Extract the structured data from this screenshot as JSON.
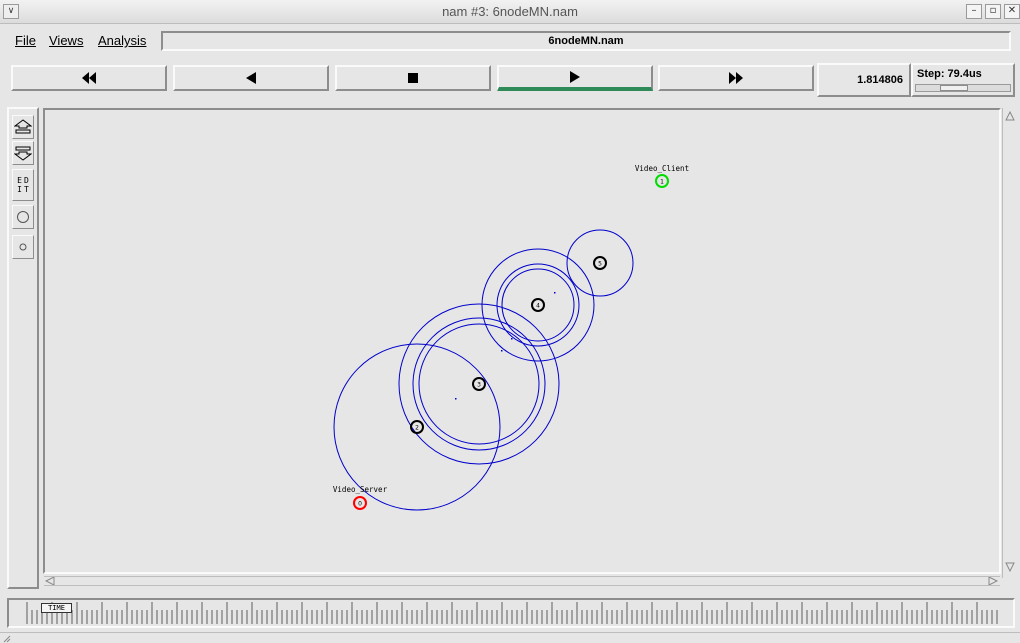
{
  "window": {
    "title": "nam #3: 6nodeMN.nam"
  },
  "menu": {
    "file": "File",
    "views": "Views",
    "analysis": "Analysis",
    "filename": "6nodeMN.nam"
  },
  "controls": {
    "rewind_icon": "fast-rewind-icon",
    "back_icon": "play-backward-icon",
    "stop_icon": "stop-icon",
    "play_icon": "play-icon",
    "forward_icon": "fast-forward-icon",
    "current_time": "1.814806",
    "step_label": "Step: 79.4us",
    "active": "play"
  },
  "tools": [
    "zoom-in-icon",
    "zoom-out-icon",
    "edit-icon",
    "circle-icon",
    "small-circle-icon"
  ],
  "tool_edit_label": "ED IT",
  "scene": {
    "nodes": [
      {
        "id": "0",
        "label": "Video_Server",
        "color": "#ff0000"
      },
      {
        "id": "1",
        "label": "Video_Client",
        "color": "#00dd00"
      },
      {
        "id": "2",
        "label": "",
        "color": "#000000"
      },
      {
        "id": "3",
        "label": "",
        "color": "#000000"
      },
      {
        "id": "4",
        "label": "",
        "color": "#000000"
      },
      {
        "id": "5",
        "label": "",
        "color": "#000000"
      }
    ],
    "range_ring_color": "#0000cc"
  },
  "timeline": {
    "tag": "TIME"
  }
}
